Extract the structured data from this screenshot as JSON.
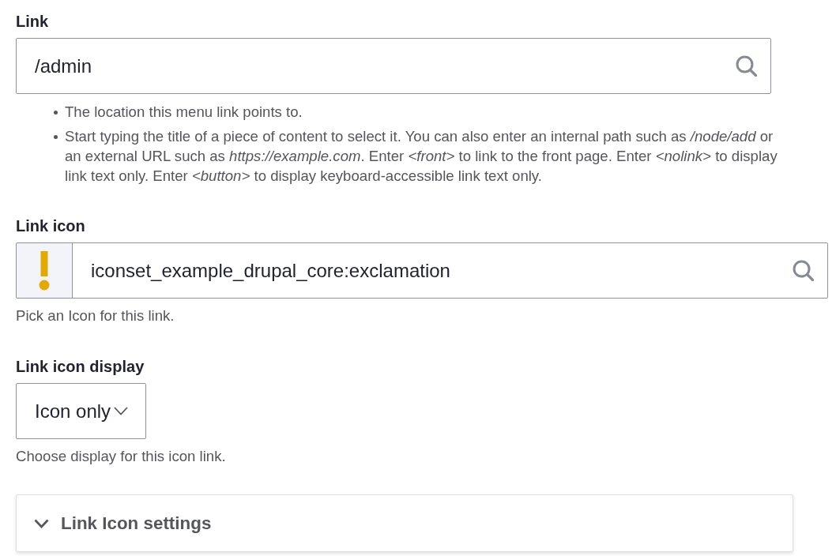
{
  "fields": [
    {
      "kind": "search",
      "label": "Link",
      "value": "/admin",
      "description_items": [
        "The location this menu link points to.",
        "Start typing the title of a piece of content to select it. You can also enter an internal path such as */node/add* or an external URL such as *https://example.com*. Enter *<front>* to link to the front page. Enter *<nolink>* to display link text only. Enter *<button>* to display keyboard-accessible link text only."
      ]
    },
    {
      "kind": "icon_picker",
      "label": "Link icon",
      "value": "iconset_example_drupal_core:exclamation",
      "description": "Pick an Icon for this link."
    },
    {
      "kind": "select",
      "label": "Link icon display",
      "value": "Icon only",
      "description": "Choose display for this icon link."
    }
  ],
  "details": {
    "summary": "Link Icon settings",
    "expanded": false
  }
}
